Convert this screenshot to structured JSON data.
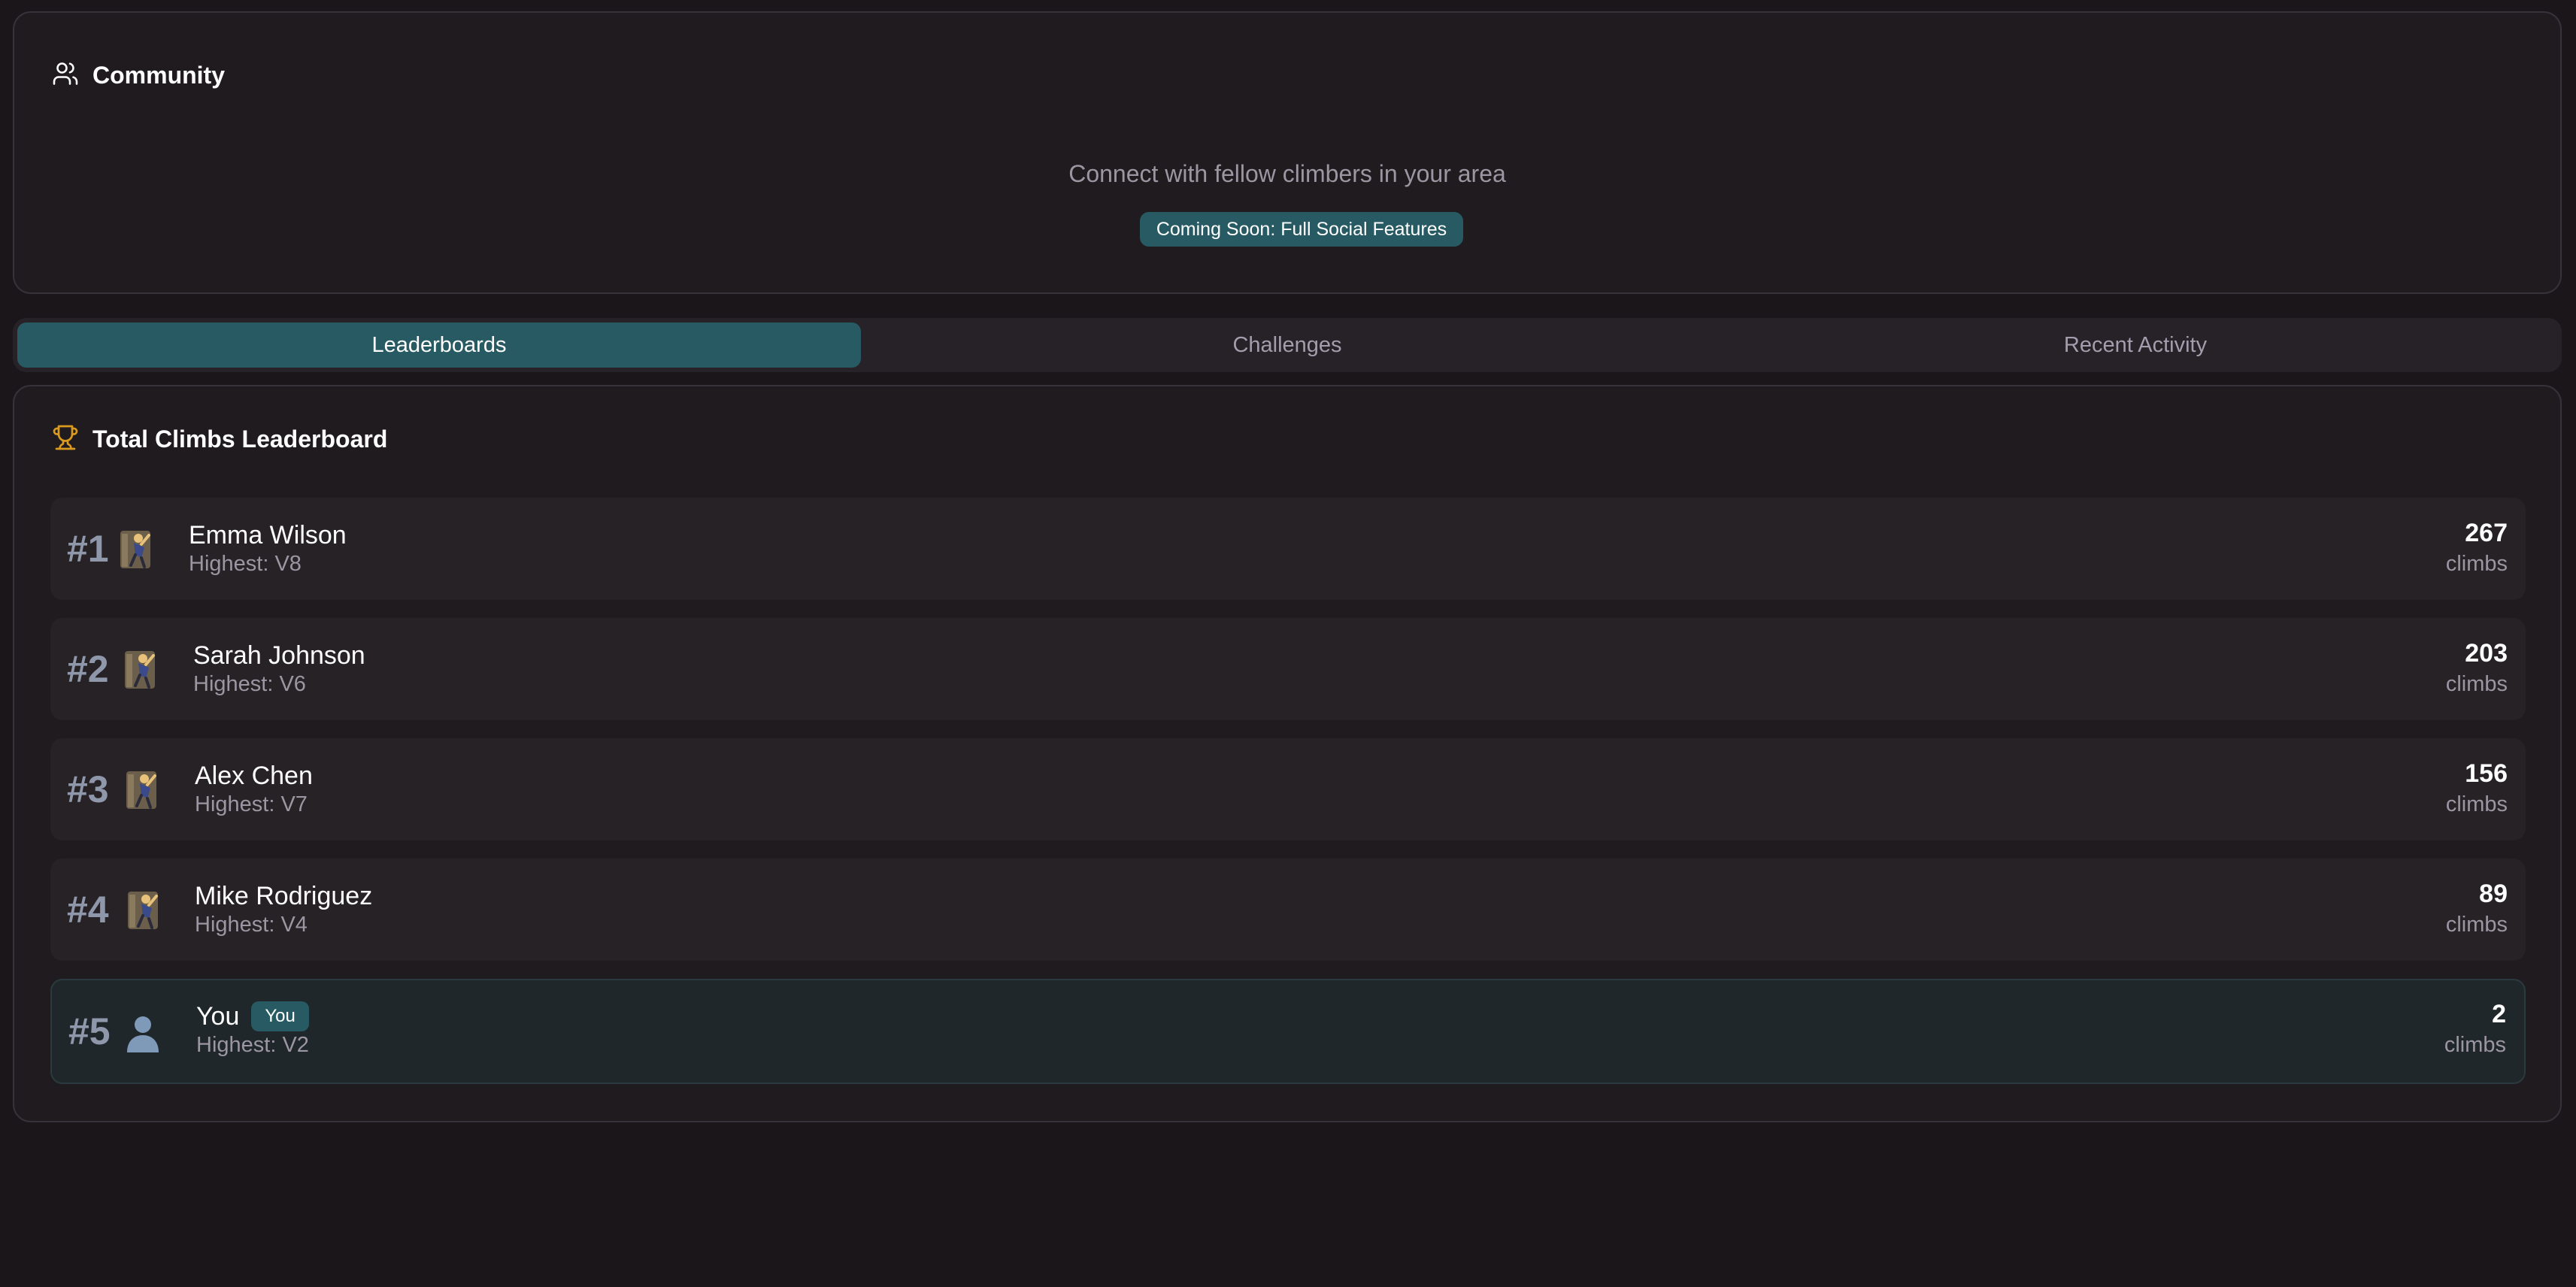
{
  "community": {
    "title": "Community",
    "subtitle": "Connect with fellow climbers in your area",
    "badge": "Coming Soon: Full Social Features"
  },
  "tabs": [
    {
      "label": "Leaderboards",
      "active": true
    },
    {
      "label": "Challenges",
      "active": false
    },
    {
      "label": "Recent Activity",
      "active": false
    }
  ],
  "leaderboard": {
    "title": "Total Climbs Leaderboard",
    "entries": [
      {
        "rank": "#1",
        "name": "Emma Wilson",
        "highest": "Highest: V8",
        "count": "267",
        "unit": "climbs",
        "avatar": "climber-icon"
      },
      {
        "rank": "#2",
        "name": "Sarah Johnson",
        "highest": "Highest: V6",
        "count": "203",
        "unit": "climbs",
        "avatar": "climber-icon"
      },
      {
        "rank": "#3",
        "name": "Alex Chen",
        "highest": "Highest: V7",
        "count": "156",
        "unit": "climbs",
        "avatar": "climber-icon"
      },
      {
        "rank": "#4",
        "name": "Mike Rodriguez",
        "highest": "Highest: V4",
        "count": "89",
        "unit": "climbs",
        "avatar": "climber-icon"
      },
      {
        "rank": "#5",
        "name": "You",
        "badge": "You",
        "highest": "Highest: V2",
        "count": "2",
        "unit": "climbs",
        "avatar": "user-silhouette-icon"
      }
    ]
  },
  "colors": {
    "background": "#1a1619",
    "card": "#1f1b1f",
    "accent": "#285a63",
    "trophy": "#d99a1e"
  }
}
